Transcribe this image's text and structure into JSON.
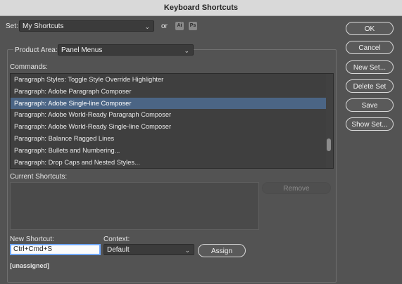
{
  "window": {
    "title": "Keyboard Shortcuts"
  },
  "set": {
    "label": "Set:",
    "value": "My Shortcuts",
    "or_label": "or",
    "badges": [
      "Ai",
      "Ps"
    ]
  },
  "product_area": {
    "label": "Product Area:",
    "value": "Panel Menus"
  },
  "commands": {
    "label": "Commands:",
    "items": [
      "Paragraph Styles: Toggle Style Override Highlighter",
      "Paragraph: Adobe Paragraph Composer",
      "Paragraph: Adobe Single-line Composer",
      "Paragraph: Adobe World-Ready Paragraph Composer",
      "Paragraph: Adobe World-Ready Single-line Composer",
      "Paragraph: Balance Ragged Lines",
      "Paragraph: Bullets and Numbering...",
      "Paragraph: Drop Caps and Nested Styles..."
    ],
    "selected_index": 2
  },
  "current_shortcuts": {
    "label": "Current Shortcuts:",
    "remove_label": "Remove"
  },
  "new_shortcut": {
    "label": "New Shortcut:",
    "value": "Ctrl+Cmd+S",
    "status": "[unassigned]"
  },
  "context": {
    "label": "Context:",
    "value": "Default"
  },
  "buttons": {
    "ok": "OK",
    "cancel": "Cancel",
    "new_set": "New Set...",
    "delete_set": "Delete Set",
    "save": "Save",
    "show_set": "Show Set...",
    "assign": "Assign"
  },
  "colors": {
    "background": "#535353",
    "selection": "#4b6585",
    "title_bar": "#d9d9d9"
  }
}
